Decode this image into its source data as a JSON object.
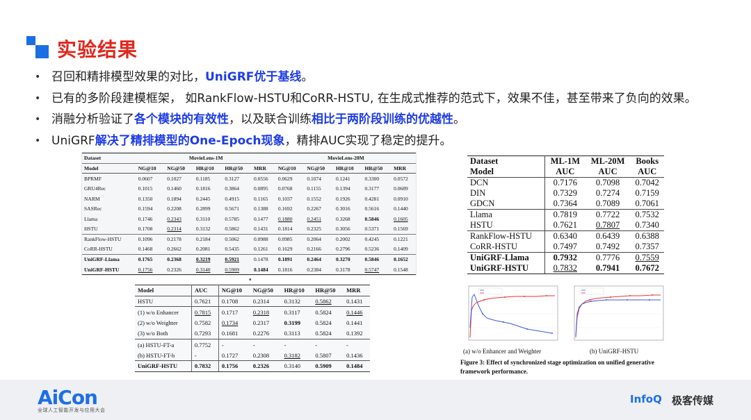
{
  "slide": {
    "title": "实验结果",
    "bullets": [
      {
        "parts": [
          {
            "text": "召回和精排模型效果的对比，",
            "hl": false
          },
          {
            "text": "UniGRF优于基线",
            "hl": true
          },
          {
            "text": "。",
            "hl": false
          }
        ]
      },
      {
        "parts": [
          {
            "text": "已有的多阶段建模框架， 如RankFlow-HSTU和CoRR-HSTU, 在生成式推荐的范式下，效果不佳，甚至带来了负向的效果。",
            "hl": false
          }
        ]
      },
      {
        "parts": [
          {
            "text": "消融分析验证了",
            "hl": false
          },
          {
            "text": "各个模块的有效性",
            "hl": true
          },
          {
            "text": "，以及联合训练",
            "hl": false
          },
          {
            "text": "相比于两阶段训练的优越性",
            "hl": true
          },
          {
            "text": "。",
            "hl": false
          }
        ]
      },
      {
        "parts": [
          {
            "text": "UniGRF",
            "hl": false
          },
          {
            "text": "解决了精排模型的One-Epoch现象",
            "hl": true
          },
          {
            "text": "，精排AUC实现了稳定的提升。",
            "hl": false
          }
        ]
      }
    ]
  },
  "table_main": {
    "dataset_label": "Dataset",
    "group1": "MovieLens-1M",
    "group2": "MovieLens-20M",
    "headers": [
      "Model",
      "NG@10",
      "NG@50",
      "HR@10",
      "HR@50",
      "MRR",
      "NG@10",
      "NG@50",
      "HR@10",
      "HR@50",
      "MRR"
    ],
    "rows": [
      [
        "BPRMF",
        "0.0607",
        "0.1027",
        "0.1185",
        "0.3127",
        "0.0556",
        "0.0629",
        "0.1074",
        "0.1241",
        "0.3300",
        "0.0572"
      ],
      [
        "GRU4Rec",
        "0.1015",
        "0.1460",
        "0.1816",
        "0.3864",
        "0.0895",
        "0.0768",
        "0.1155",
        "0.1394",
        "0.3177",
        "0.0689"
      ],
      [
        "NARM",
        "0.1350",
        "0.1894",
        "0.2445",
        "0.4915",
        "0.1165",
        "0.1037",
        "0.1552",
        "0.1926",
        "0.4281",
        "0.0910"
      ],
      [
        "SASRec",
        "0.1594",
        "0.2208",
        "0.2899",
        "0.5671",
        "0.1388",
        "0.1692",
        "0.2267",
        "0.3016",
        "0.5616",
        "0.1440"
      ],
      [
        "Llama",
        "0.1746",
        "0.2343",
        "0.3110",
        "0.5785",
        "0.1477",
        "0.1880",
        "0.2451",
        "0.3268",
        "0.5846",
        "0.1605"
      ],
      [
        "HSTU",
        "0.1708",
        "0.2314",
        "0.3132",
        "0.5862",
        "0.1431",
        "0.1814",
        "0.2325",
        "0.3056",
        "0.5371",
        "0.1569"
      ],
      [
        "RankFlow-HSTU",
        "0.1096",
        "0.2178",
        "0.2184",
        "0.5062",
        "0.0988",
        "0.0985",
        "0.2064",
        "0.2002",
        "0.4245",
        "0.1221"
      ],
      [
        "CoRR-HSTU",
        "0.1468",
        "0.2662",
        "0.2081",
        "0.5435",
        "0.1261",
        "0.1629",
        "0.2166",
        "0.2796",
        "0.5236",
        "0.1409"
      ],
      [
        "UniGRF-Llama",
        "0.1765",
        "0.2368",
        "0.3219",
        "0.5921",
        "0.1478",
        "0.1891",
        "0.2464",
        "0.3270",
        "0.5846",
        "0.1652"
      ],
      [
        "UniGRF-HSTU",
        "0.1756",
        "0.2326",
        "0.3140",
        "0.5909",
        "0.1484",
        "0.1816",
        "0.2384",
        "0.3178",
        "0.5747",
        "0.1548"
      ]
    ]
  },
  "table_auc": {
    "headers": [
      "Dataset",
      "ML-1M",
      "ML-20M",
      "Books"
    ],
    "subheaders": [
      "Model",
      "AUC",
      "AUC",
      "AUC"
    ],
    "rows": [
      [
        "DCN",
        "0.7176",
        "0.7098",
        "0.7042"
      ],
      [
        "DIN",
        "0.7329",
        "0.7274",
        "0.7159"
      ],
      [
        "GDCN",
        "0.7364",
        "0.7089",
        "0.7061"
      ],
      [
        "Llama",
        "0.7819",
        "0.7722",
        "0.7532"
      ],
      [
        "HSTU",
        "0.7621",
        "0.7807",
        "0.7340"
      ],
      [
        "RankFlow-HSTU",
        "0.6340",
        "0.6439",
        "0.6388"
      ],
      [
        "CoRR-HSTU",
        "0.7497",
        "0.7492",
        "0.7357"
      ],
      [
        "UniGRF-Llama",
        "0.7932",
        "0.7776",
        "0.7559"
      ],
      [
        "UniGRF-HSTU",
        "0.7832",
        "0.7941",
        "0.7672"
      ]
    ]
  },
  "table_ablation": {
    "headers": [
      "Model",
      "AUC",
      "NG@10",
      "NG@50",
      "HR@10",
      "HR@50",
      "MRR"
    ],
    "rows": [
      [
        "HSTU",
        "0.7621",
        "0.1708",
        "0.2314",
        "0.3132",
        "0.5862",
        "0.1431"
      ],
      [
        "(1) w/o Enhancer",
        "0.7815",
        "0.1717",
        "0.2318",
        "0.3117",
        "0.5824",
        "0.1446"
      ],
      [
        "(2) w/o Weighter",
        "0.7582",
        "0.1734",
        "0.2317",
        "0.3199",
        "0.5824",
        "0.1441"
      ],
      [
        "(3) w/o Both",
        "0.7293",
        "0.1681",
        "0.2276",
        "0.3113",
        "0.5824",
        "0.1392"
      ],
      [
        "(a) HSTU-FT-a",
        "0.7752",
        "-",
        "-",
        "-",
        "-",
        "-"
      ],
      [
        "(b) HSTU-FT-b",
        "-",
        "0.1727",
        "0.2308",
        "0.3182",
        "0.5807",
        "0.1436"
      ],
      [
        "UniGRF-HSTU",
        "0.7832",
        "0.1756",
        "0.2326",
        "0.3140",
        "0.5909",
        "0.1484"
      ]
    ]
  },
  "figure": {
    "caption_a": "(a) w/o Enhancer and Weighter",
    "caption_b": "(b) UniGRF-HSTU",
    "caption": "Figure 3: Effect of synchronized stage optimization on unified generative framework performance."
  },
  "footer": {
    "brand": "AiCon",
    "brand_sub": "全球人工智能开发与应用大会",
    "infoq": "InfoQ",
    "partner": "极客传媒"
  },
  "colors": {
    "title_red": "#e1271d",
    "highlight_blue": "#1f3de6",
    "brand_blue": "#1f6ee8"
  }
}
